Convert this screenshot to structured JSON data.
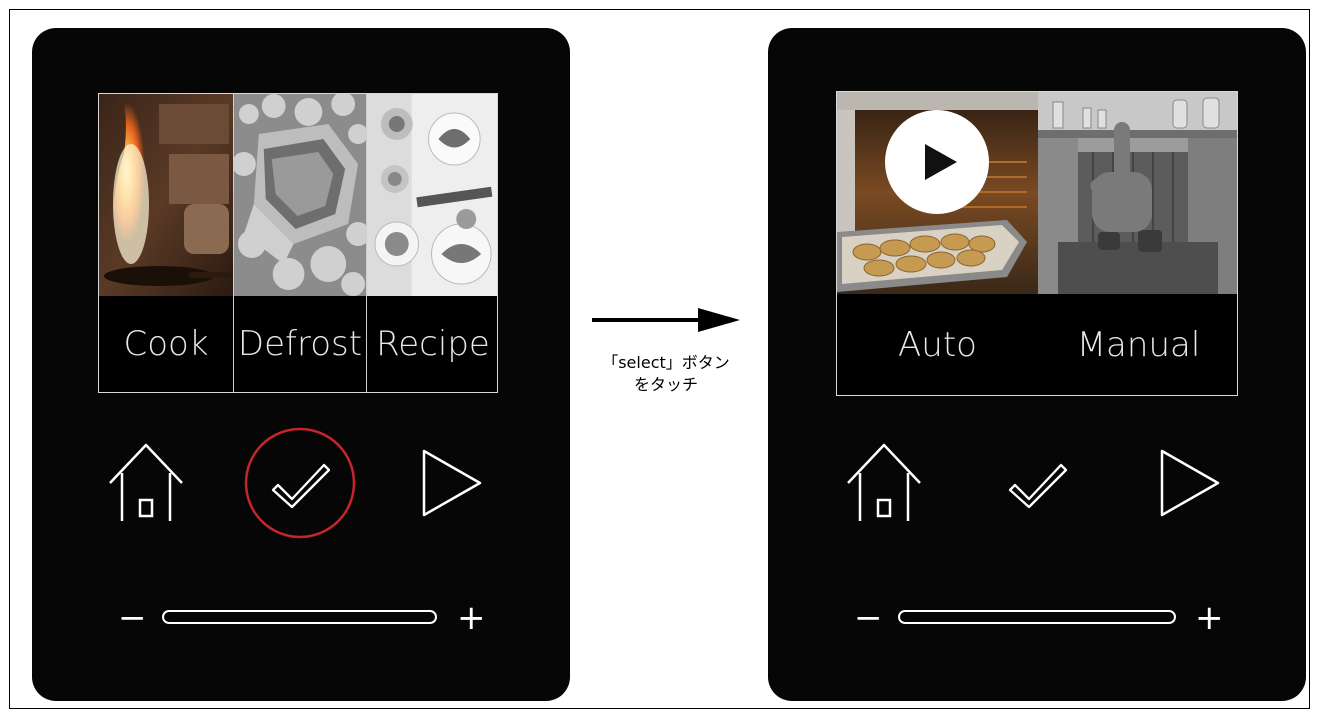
{
  "left_panel": {
    "menu": [
      {
        "label": "Cook"
      },
      {
        "label": "Defrost"
      },
      {
        "label": "Recipe"
      }
    ],
    "slider": {
      "minus": "−",
      "plus": "+"
    }
  },
  "right_panel": {
    "menu": [
      {
        "label": "Auto"
      },
      {
        "label": "Manual"
      }
    ],
    "slider": {
      "minus": "−",
      "plus": "+"
    }
  },
  "transition": {
    "caption_line1": "「select」ボタン",
    "caption_line2": "をタッチ"
  },
  "colors": {
    "device_bg": "#060606",
    "highlight_ring": "#c3262b",
    "icon_stroke": "#ffffff"
  },
  "icons": [
    "home-icon",
    "checkmark-icon",
    "play-arrow-icon",
    "play-button-icon",
    "hand-pointer-icon"
  ]
}
